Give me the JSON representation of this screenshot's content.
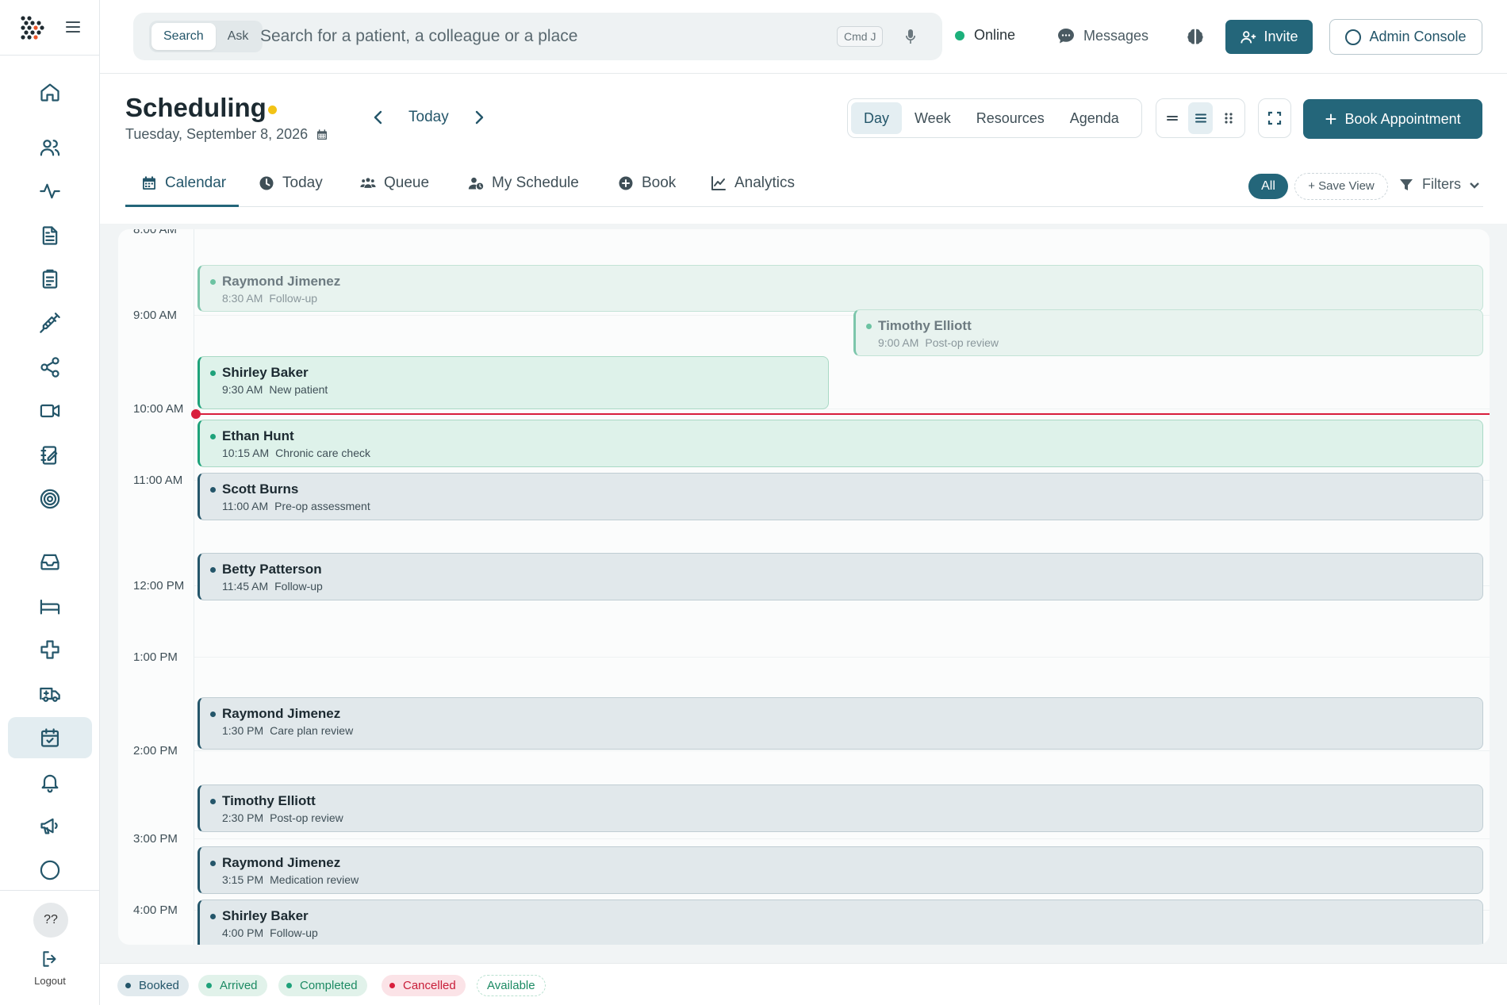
{
  "search": {
    "mode_search": "Search",
    "mode_ask": "Ask",
    "placeholder": "Search for a patient, a colleague or a place",
    "shortcut": "Cmd J"
  },
  "topbar": {
    "status": "Online",
    "messages": "Messages",
    "invite": "Invite",
    "admin": "Admin Console"
  },
  "header": {
    "title": "Scheduling",
    "date": "Tuesday, September 8, 2026",
    "today": "Today",
    "views": [
      "Day",
      "Week",
      "Resources",
      "Agenda"
    ],
    "active_view": "Day",
    "book": "Book Appointment"
  },
  "tabs": [
    "Calendar",
    "Today",
    "Queue",
    "My Schedule",
    "Book",
    "Analytics"
  ],
  "filters": {
    "all": "All",
    "save_view": "+ Save View",
    "filters": "Filters"
  },
  "sidebar": {
    "help": "??",
    "logout": "Logout",
    "icons": [
      "home-icon",
      "users-icon",
      "activity-icon",
      "document-icon",
      "clipboard-icon",
      "syringe-icon",
      "share-icon",
      "video-icon",
      "notebook-icon",
      "target-icon",
      "inbox-icon",
      "bed-icon",
      "medical-cross-icon",
      "ambulance-icon",
      "calendar-check-icon",
      "bell-icon",
      "megaphone-icon",
      "circle-icon"
    ]
  },
  "timeline": {
    "partial_top_label": "8:00 AM",
    "hours": [
      "9:00 AM",
      "10:00 AM",
      "11:00 AM",
      "12:00 PM",
      "1:00 PM",
      "2:00 PM",
      "3:00 PM",
      "4:00 PM"
    ],
    "current_time": "10:04 AM"
  },
  "appointments": [
    {
      "name": "Raymond Jimenez",
      "time": "8:30 AM",
      "type": "Follow-up",
      "status": "completed"
    },
    {
      "name": "Timothy Elliott",
      "time": "9:00 AM",
      "type": "Post-op review",
      "status": "completed"
    },
    {
      "name": "Shirley Baker",
      "time": "9:30 AM",
      "type": "New patient",
      "status": "arrived"
    },
    {
      "name": "Ethan Hunt",
      "time": "10:15 AM",
      "type": "Chronic care check",
      "status": "arrived"
    },
    {
      "name": "Scott Burns",
      "time": "11:00 AM",
      "type": "Pre-op assessment",
      "status": "booked"
    },
    {
      "name": "Betty Patterson",
      "time": "11:45 AM",
      "type": "Follow-up",
      "status": "booked"
    },
    {
      "name": "Raymond Jimenez",
      "time": "1:30 PM",
      "type": "Care plan review",
      "status": "booked"
    },
    {
      "name": "Timothy Elliott",
      "time": "2:30 PM",
      "type": "Post-op review",
      "status": "booked"
    },
    {
      "name": "Raymond Jimenez",
      "time": "3:15 PM",
      "type": "Medication review",
      "status": "booked"
    },
    {
      "name": "Shirley Baker",
      "time": "4:00 PM",
      "type": "Follow-up",
      "status": "booked"
    }
  ],
  "legend": [
    "Booked",
    "Arrived",
    "Completed",
    "Cancelled",
    "Available"
  ],
  "colors": {
    "brand": "#24667a",
    "arrived": "#1ea27a",
    "cancelled": "#d81e3c",
    "pending": "#f2c316"
  }
}
